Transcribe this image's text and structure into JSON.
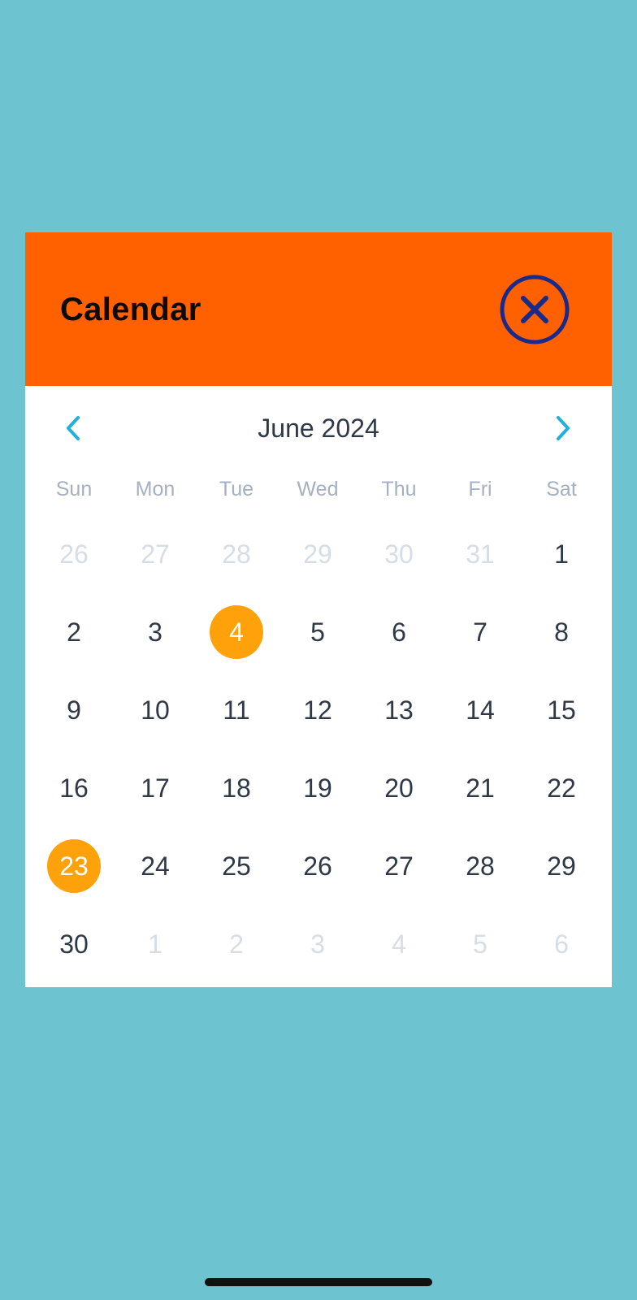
{
  "modal": {
    "title": "Calendar"
  },
  "calendar": {
    "month_label": "June 2024",
    "weekdays": [
      "Sun",
      "Mon",
      "Tue",
      "Wed",
      "Thu",
      "Fri",
      "Sat"
    ],
    "weeks": [
      [
        {
          "n": "26",
          "outside": true
        },
        {
          "n": "27",
          "outside": true
        },
        {
          "n": "28",
          "outside": true
        },
        {
          "n": "29",
          "outside": true
        },
        {
          "n": "30",
          "outside": true
        },
        {
          "n": "31",
          "outside": true
        },
        {
          "n": "1"
        }
      ],
      [
        {
          "n": "2"
        },
        {
          "n": "3"
        },
        {
          "n": "4",
          "selected": true
        },
        {
          "n": "5"
        },
        {
          "n": "6"
        },
        {
          "n": "7"
        },
        {
          "n": "8"
        }
      ],
      [
        {
          "n": "9"
        },
        {
          "n": "10"
        },
        {
          "n": "11"
        },
        {
          "n": "12"
        },
        {
          "n": "13"
        },
        {
          "n": "14"
        },
        {
          "n": "15"
        }
      ],
      [
        {
          "n": "16"
        },
        {
          "n": "17"
        },
        {
          "n": "18"
        },
        {
          "n": "19"
        },
        {
          "n": "20"
        },
        {
          "n": "21"
        },
        {
          "n": "22"
        }
      ],
      [
        {
          "n": "23",
          "selected": true
        },
        {
          "n": "24"
        },
        {
          "n": "25"
        },
        {
          "n": "26"
        },
        {
          "n": "27"
        },
        {
          "n": "28"
        },
        {
          "n": "29"
        }
      ],
      [
        {
          "n": "30"
        },
        {
          "n": "1",
          "outside": true
        },
        {
          "n": "2",
          "outside": true
        },
        {
          "n": "3",
          "outside": true
        },
        {
          "n": "4",
          "outside": true
        },
        {
          "n": "5",
          "outside": true
        },
        {
          "n": "6",
          "outside": true
        }
      ]
    ]
  },
  "icons": {
    "close": "close-circle-icon",
    "prev": "chevron-left-icon",
    "next": "chevron-right-icon"
  },
  "colors": {
    "background": "#6dc3cf",
    "header": "#ff6000",
    "selected_day": "#ffa10a",
    "close_icon": "#1a2a8a",
    "nav_arrow": "#1fb0dc",
    "text_primary": "#2e3846",
    "text_muted": "#a5b1c0",
    "text_outside": "#d6dde5"
  }
}
